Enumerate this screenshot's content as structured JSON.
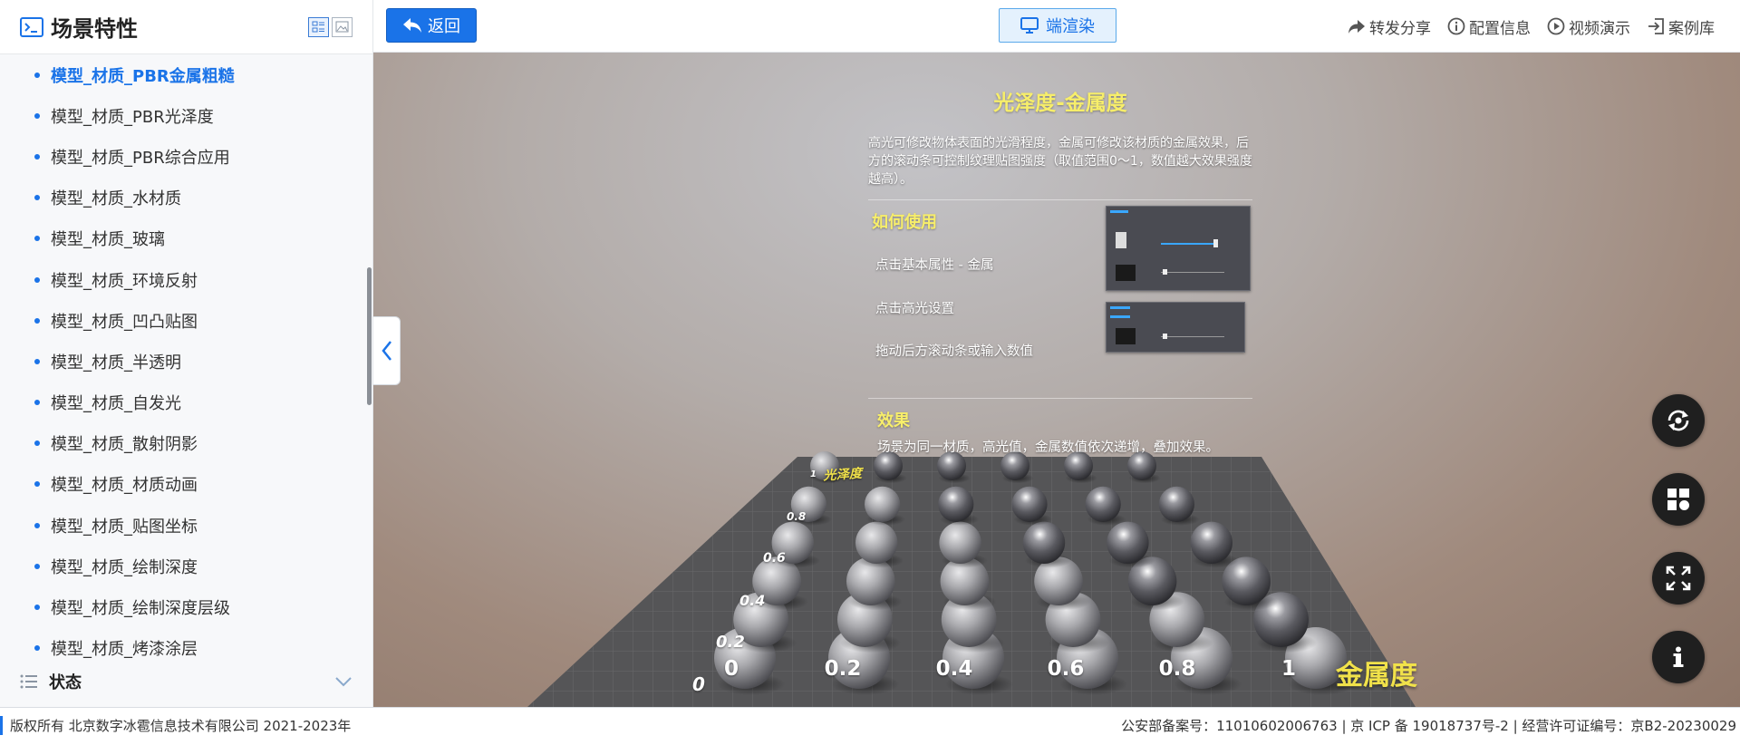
{
  "sidebar": {
    "title": "场景特性",
    "items": [
      {
        "label": "模型_材质_PBR金属粗糙",
        "active": true
      },
      {
        "label": "模型_材质_PBR光泽度"
      },
      {
        "label": "模型_材质_PBR综合应用"
      },
      {
        "label": "模型_材质_水材质"
      },
      {
        "label": "模型_材质_玻璃"
      },
      {
        "label": "模型_材质_环境反射"
      },
      {
        "label": "模型_材质_凹凸贴图"
      },
      {
        "label": "模型_材质_半透明"
      },
      {
        "label": "模型_材质_自发光"
      },
      {
        "label": "模型_材质_散射阴影"
      },
      {
        "label": "模型_材质_材质动画"
      },
      {
        "label": "模型_材质_贴图坐标"
      },
      {
        "label": "模型_材质_绘制深度"
      },
      {
        "label": "模型_材质_绘制深度层级"
      },
      {
        "label": "模型_材质_烤漆涂层"
      }
    ],
    "group": {
      "label": "状态"
    }
  },
  "topbar": {
    "back_label": "返回",
    "render_label": "端渲染",
    "actions": {
      "share": "转发分享",
      "config": "配置信息",
      "video": "视频演示",
      "cases": "案例库"
    }
  },
  "panel": {
    "title": "光泽度-金属度",
    "description": "高光可修改物体表面的光滑程度，金属可修改该材质的金属效果，后方的滚动条可控制纹理贴图强度（取值范围0～1，数值越大效果强度越高）。",
    "howto_heading": "如何使用",
    "steps": [
      "点击基本属性 - 金属",
      "点击高光设置",
      "拖动后方滚动条或输入数值"
    ],
    "effect_heading": "效果",
    "effect_text": "场景为同一材质，高光值，金属数值依次递增，叠加效果。"
  },
  "scene": {
    "y_axis_title": "光泽度",
    "x_axis_title": "金属度",
    "x_ticks": [
      "0",
      "0.2",
      "0.4",
      "0.6",
      "0.8",
      "1"
    ],
    "y_ticks": [
      "0",
      "0.2",
      "0.4",
      "0.6",
      "0.8",
      "1"
    ]
  },
  "colors": {
    "accent": "#1a73e8",
    "panel_heading": "#f7ee6a",
    "axis_title": "#f1e24a"
  },
  "icons": {
    "rotate": "rotate-icon",
    "layout": "layout-icon",
    "fullscreen": "fullscreen-icon",
    "info": "info-icon"
  },
  "footer": {
    "copyright": "版权所有 北京数字冰雹信息技术有限公司 2021-2023年",
    "license": "公安部备案号：11010602006763 | 京 ICP 备 19018737号-2 | 经营许可证编号：京B2-20230029"
  }
}
